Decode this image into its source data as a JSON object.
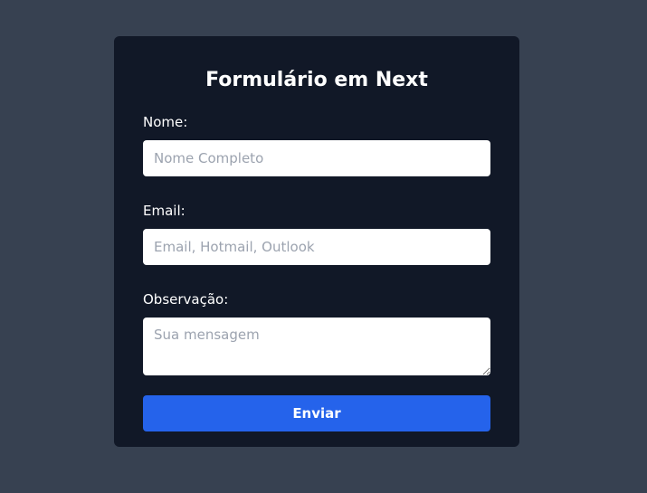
{
  "form": {
    "title": "Formulário em Next",
    "fields": {
      "nome": {
        "label": "Nome:",
        "placeholder": "Nome Completo",
        "value": ""
      },
      "email": {
        "label": "Email:",
        "placeholder": "Email, Hotmail, Outlook",
        "value": ""
      },
      "observacao": {
        "label": "Observação:",
        "placeholder": "Sua mensagem",
        "value": ""
      }
    },
    "submit_label": "Enviar"
  },
  "colors": {
    "page_background": "#374151",
    "card_background": "#111827",
    "input_background": "#ffffff",
    "placeholder_text": "#9ca3af",
    "button_background": "#2563eb",
    "label_text": "#ffffff"
  }
}
